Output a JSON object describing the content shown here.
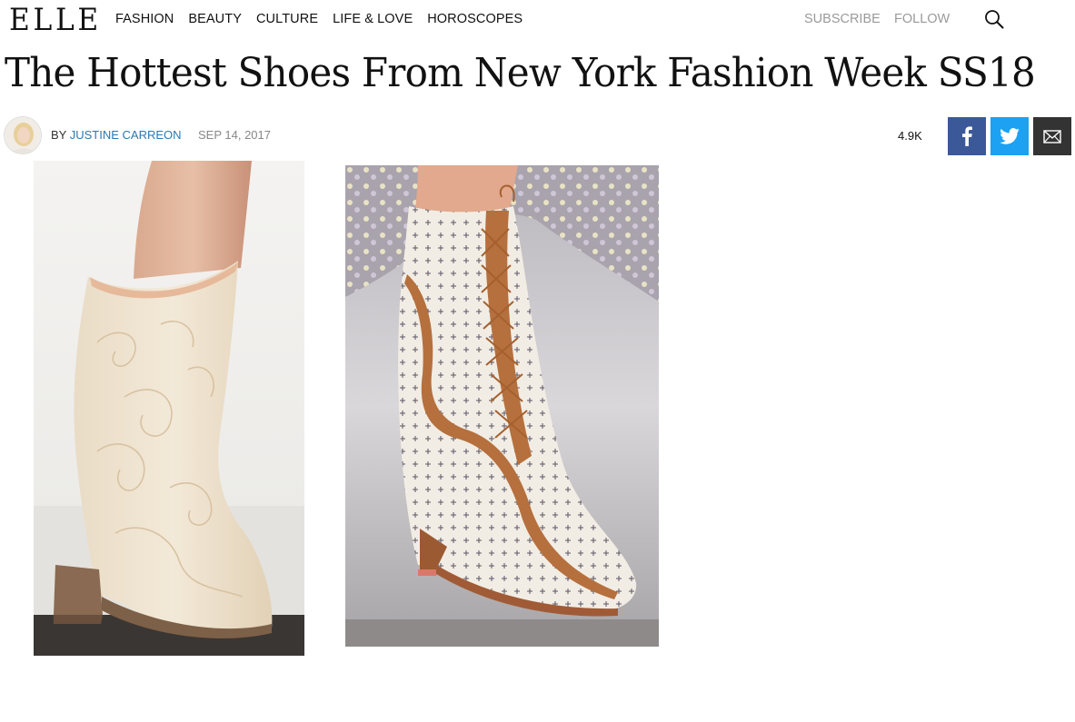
{
  "brand": {
    "logo": "ELLE"
  },
  "nav": {
    "items": [
      {
        "label": "FASHION"
      },
      {
        "label": "BEAUTY"
      },
      {
        "label": "CULTURE"
      },
      {
        "label": "LIFE & LOVE"
      },
      {
        "label": "HOROSCOPES"
      }
    ],
    "subscribe": "SUBSCRIBE",
    "follow": "FOLLOW",
    "search_icon": "search-icon"
  },
  "article": {
    "title": "The Hottest Shoes From New York Fashion Week SS18",
    "by": "BY",
    "author": "JUSTINE CARREON",
    "date": "SEP 14, 2017",
    "share_count": "4.9K"
  },
  "share": {
    "facebook_icon": "facebook-icon",
    "twitter_icon": "twitter-icon",
    "email_icon": "email-icon",
    "facebook_color": "#3b5998",
    "twitter_color": "#1da1f2",
    "email_color": "#333333"
  },
  "images": [
    {
      "subject": "cream tooled western boot with stacked heel"
    },
    {
      "subject": "cream floral-print lace-up boot with tan leather trim"
    }
  ],
  "colors": {
    "author_link": "#2a79b3",
    "muted_nav": "#9a9a9a"
  }
}
